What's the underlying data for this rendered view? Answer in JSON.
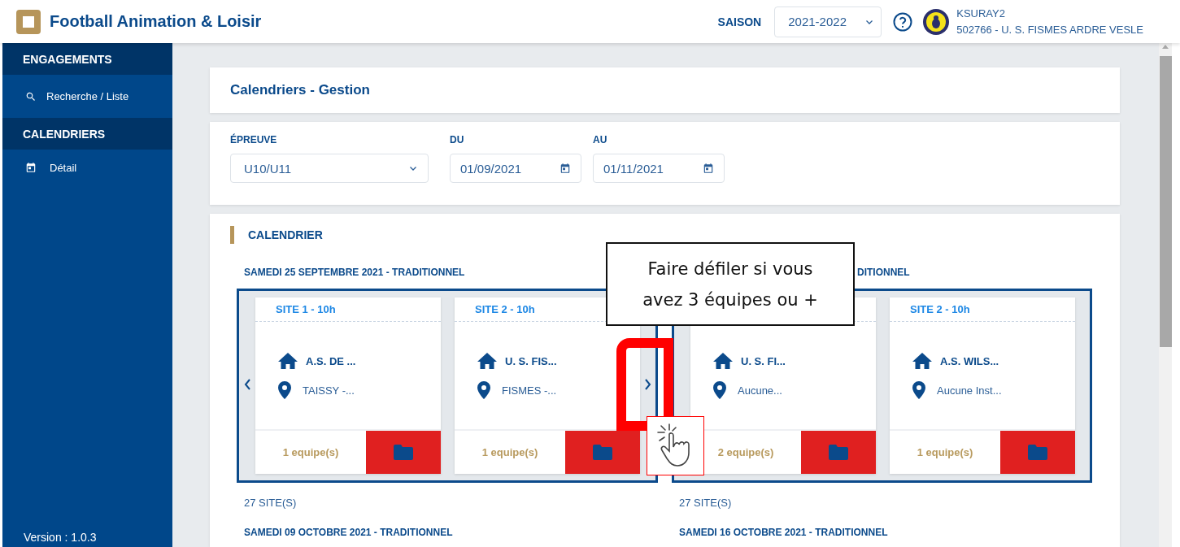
{
  "app": {
    "title": "Football Animation & Loisir"
  },
  "header": {
    "season_label": "SAISON",
    "season_select": {
      "value": "2021-2022"
    },
    "user": {
      "login": "KSURAY2",
      "club": "502766 - U. S. FISMES ARDRE VESLE"
    }
  },
  "sidebar": {
    "sections": [
      {
        "title": "ENGAGEMENTS",
        "items": [
          {
            "label": "Recherche / Liste"
          }
        ]
      },
      {
        "title": "CALENDRIERS",
        "items": [
          {
            "label": "Détail"
          }
        ]
      }
    ],
    "version": "Version : 1.0.3"
  },
  "page_title": "Calendriers - Gestion",
  "filters": [
    {
      "label": "ÉPREUVE",
      "kind": "select",
      "value": "U10/U11"
    },
    {
      "label": "DU",
      "kind": "date",
      "value": "01/09/2021"
    },
    {
      "label": "AU",
      "kind": "date",
      "value": "01/11/2021"
    }
  ],
  "calendar": {
    "title": "CALENDRIER",
    "days": [
      {
        "title": "SAMEDI 25 SEPTEMBRE 2021 - TRADITIONNEL",
        "show_prev": true,
        "show_next": true,
        "site_count": "27 SITE(S)",
        "sites": [
          {
            "label": "SITE 1 - 10h",
            "club": "A.S. DE ...",
            "venue": "TAISSY -...",
            "teams": "1 equipe(s)"
          },
          {
            "label": "SITE 2 - 10h",
            "club": "U. S. FIS...",
            "venue": "FISMES -...",
            "teams": "1 equipe(s)"
          }
        ]
      },
      {
        "title": "DITIONNEL",
        "show_prev": false,
        "show_next": false,
        "site_count": "27 SITE(S)",
        "sites": [
          {
            "club": "U. S. FI...",
            "venue": "Aucune...",
            "teams": "2 equipe(s)"
          },
          {
            "label": "SITE 2 - 10h",
            "club": "A.S. WILS...",
            "venue": "Aucune Inst...",
            "teams": "1 equipe(s)"
          }
        ]
      }
    ],
    "next_days": [
      "SAMEDI 09 OCTOBRE 2021 - TRADITIONNEL",
      "SAMEDI 16 OCTOBRE 2021 - TRADITIONNEL"
    ]
  },
  "callout": {
    "text": "Faire défiler si vous avez 3 équipes ou +"
  }
}
